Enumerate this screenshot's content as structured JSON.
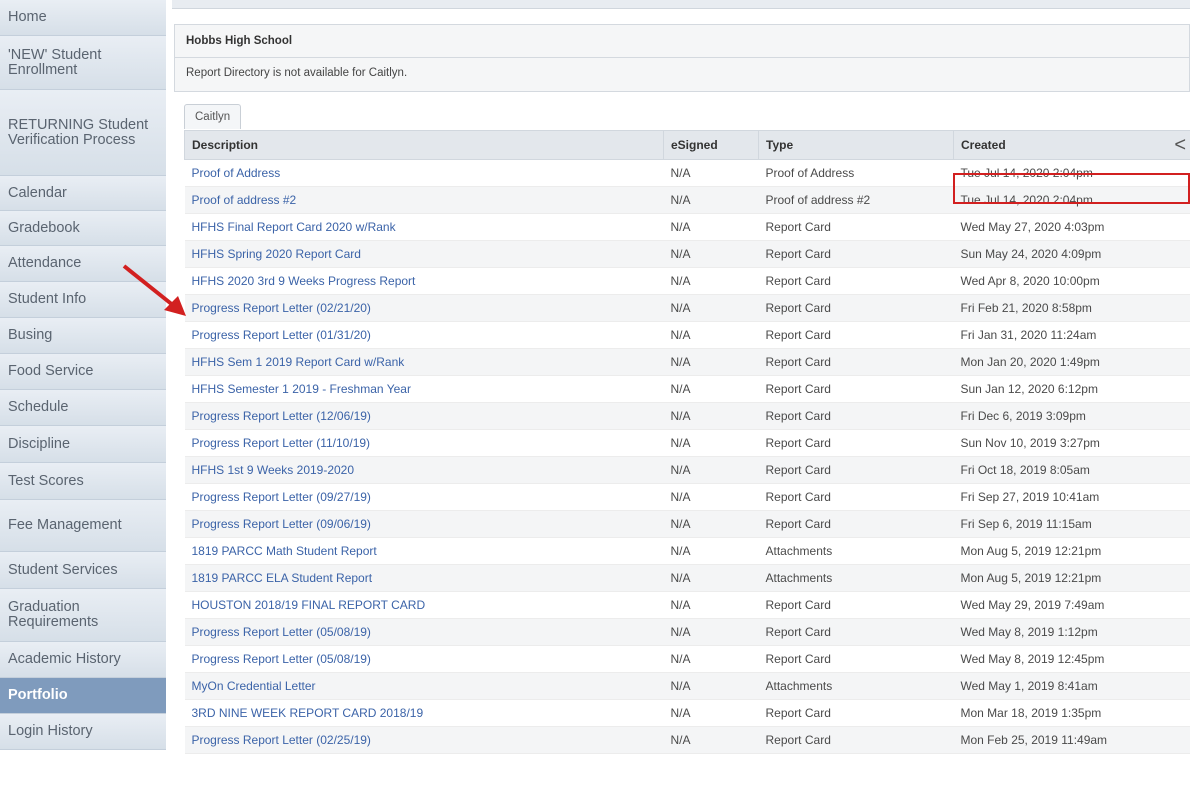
{
  "sidebar": {
    "items": [
      {
        "label": "Home"
      },
      {
        "label": "'NEW' Student Enrollment"
      },
      {
        "label": "RETURNING Student Verification Process"
      },
      {
        "label": "Calendar"
      },
      {
        "label": "Gradebook"
      },
      {
        "label": "Attendance"
      },
      {
        "label": "Student Info"
      },
      {
        "label": "Busing"
      },
      {
        "label": "Food Service"
      },
      {
        "label": "Schedule"
      },
      {
        "label": "Discipline"
      },
      {
        "label": "Test Scores"
      },
      {
        "label": "Fee Management"
      },
      {
        "label": "Student Services"
      },
      {
        "label": "Graduation Requirements"
      },
      {
        "label": "Academic History"
      },
      {
        "label": "Portfolio"
      },
      {
        "label": "Login History"
      }
    ],
    "active": "Portfolio"
  },
  "school": {
    "name": "Hobbs High School",
    "message": "Report Directory is not available for Caitlyn."
  },
  "tab": {
    "label": "Caitlyn"
  },
  "table": {
    "headers": [
      "Description",
      "eSigned",
      "Type",
      "Created"
    ],
    "rows": [
      {
        "description": "Proof of Address",
        "esigned": "N/A",
        "type": "Proof of Address",
        "created": "Tue Jul 14, 2020 2:04pm"
      },
      {
        "description": "Proof of address #2",
        "esigned": "N/A",
        "type": "Proof of address #2",
        "created": "Tue Jul 14, 2020 2:04pm"
      },
      {
        "description": "HFHS Final Report Card 2020 w/Rank",
        "esigned": "N/A",
        "type": "Report Card",
        "created": "Wed May 27, 2020 4:03pm"
      },
      {
        "description": "HFHS Spring 2020 Report Card",
        "esigned": "N/A",
        "type": "Report Card",
        "created": "Sun May 24, 2020 4:09pm"
      },
      {
        "description": "HFHS 2020 3rd 9 Weeks Progress Report",
        "esigned": "N/A",
        "type": "Report Card",
        "created": "Wed Apr 8, 2020 10:00pm"
      },
      {
        "description": "Progress Report Letter (02/21/20)",
        "esigned": "N/A",
        "type": "Report Card",
        "created": "Fri Feb 21, 2020 8:58pm"
      },
      {
        "description": "Progress Report Letter (01/31/20)",
        "esigned": "N/A",
        "type": "Report Card",
        "created": "Fri Jan 31, 2020 11:24am"
      },
      {
        "description": "HFHS Sem 1 2019 Report Card w/Rank",
        "esigned": "N/A",
        "type": "Report Card",
        "created": "Mon Jan 20, 2020 1:49pm"
      },
      {
        "description": "HFHS Semester 1 2019 - Freshman Year",
        "esigned": "N/A",
        "type": "Report Card",
        "created": "Sun Jan 12, 2020 6:12pm"
      },
      {
        "description": "Progress Report Letter (12/06/19)",
        "esigned": "N/A",
        "type": "Report Card",
        "created": "Fri Dec 6, 2019 3:09pm"
      },
      {
        "description": "Progress Report Letter (11/10/19)",
        "esigned": "N/A",
        "type": "Report Card",
        "created": "Sun Nov 10, 2019 3:27pm"
      },
      {
        "description": "HFHS 1st 9 Weeks 2019-2020",
        "esigned": "N/A",
        "type": "Report Card",
        "created": "Fri Oct 18, 2019 8:05am"
      },
      {
        "description": "Progress Report Letter (09/27/19)",
        "esigned": "N/A",
        "type": "Report Card",
        "created": "Fri Sep 27, 2019 10:41am"
      },
      {
        "description": "Progress Report Letter (09/06/19)",
        "esigned": "N/A",
        "type": "Report Card",
        "created": "Fri Sep 6, 2019 11:15am"
      },
      {
        "description": "1819 PARCC Math Student Report",
        "esigned": "N/A",
        "type": "Attachments",
        "created": "Mon Aug 5, 2019 12:21pm"
      },
      {
        "description": "1819 PARCC ELA Student Report",
        "esigned": "N/A",
        "type": "Attachments",
        "created": "Mon Aug 5, 2019 12:21pm"
      },
      {
        "description": "HOUSTON 2018/19 FINAL REPORT CARD",
        "esigned": "N/A",
        "type": "Report Card",
        "created": "Wed May 29, 2019 7:49am"
      },
      {
        "description": "Progress Report Letter (05/08/19)",
        "esigned": "N/A",
        "type": "Report Card",
        "created": "Wed May 8, 2019 1:12pm"
      },
      {
        "description": "Progress Report Letter (05/08/19)",
        "esigned": "N/A",
        "type": "Report Card",
        "created": "Wed May 8, 2019 12:45pm"
      },
      {
        "description": "MyOn Credential Letter",
        "esigned": "N/A",
        "type": "Attachments",
        "created": "Wed May 1, 2019 8:41am"
      },
      {
        "description": "3RD NINE WEEK REPORT CARD 2018/19",
        "esigned": "N/A",
        "type": "Report Card",
        "created": "Mon Mar 18, 2019 1:35pm"
      },
      {
        "description": "Progress Report Letter (02/25/19)",
        "esigned": "N/A",
        "type": "Report Card",
        "created": "Mon Feb 25, 2019 11:49am"
      }
    ]
  },
  "colors": {
    "link": "#3b63a8",
    "active_nav": "#7f9bbd",
    "annotation": "#d22020"
  }
}
